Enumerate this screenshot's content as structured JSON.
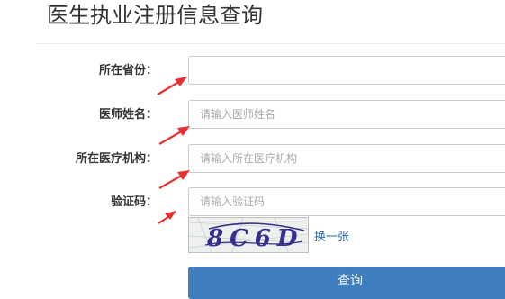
{
  "page": {
    "title": "医生执业注册信息查询"
  },
  "form": {
    "province": {
      "label": "所在省份：",
      "value": "",
      "placeholder": ""
    },
    "doctor_name": {
      "label": "医师姓名：",
      "value": "",
      "placeholder": "请输入医师姓名"
    },
    "institution": {
      "label": "所在医疗机构：",
      "value": "",
      "placeholder": "请输入所在医疗机构"
    },
    "captcha": {
      "label": "验证码：",
      "value": "",
      "placeholder": "请输入验证码",
      "image_text": "8C6D",
      "refresh_label": "换一张"
    },
    "submit_label": "查询"
  },
  "colors": {
    "arrow": "#e8322f",
    "button": "#3f7fc0",
    "captcha_text": "#3a2f8f"
  }
}
